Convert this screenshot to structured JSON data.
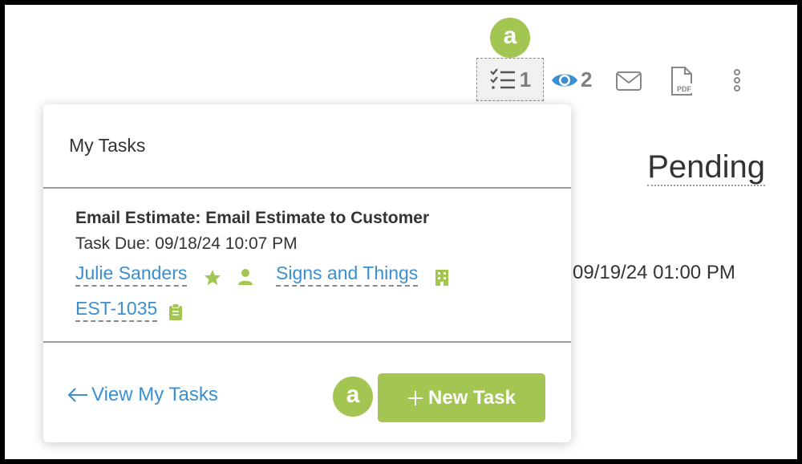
{
  "toolbar": {
    "callout_label": "a",
    "tasks_count": "1",
    "views_count": "2",
    "icons": [
      "checklist-icon",
      "eye-icon",
      "envelope-icon",
      "pdf-icon",
      "more-vert-icon"
    ],
    "pdf_label": "PDF"
  },
  "background": {
    "status": "Pending",
    "date": "09/19/24 01:00 PM"
  },
  "popup": {
    "title": "My Tasks",
    "task": {
      "title": "Email Estimate: Email Estimate to Customer",
      "due": "Task Due: 09/18/24 10:07 PM",
      "contact": "Julie Sanders",
      "company": "Signs and Things",
      "estimate": "EST-1035"
    },
    "view_link": "View My Tasks",
    "new_task_label": "New Task",
    "callout_label": "a"
  },
  "colors": {
    "accent_green": "#a3c653",
    "link_blue": "#3a8fd0",
    "eye_blue": "#3a8fd0"
  }
}
